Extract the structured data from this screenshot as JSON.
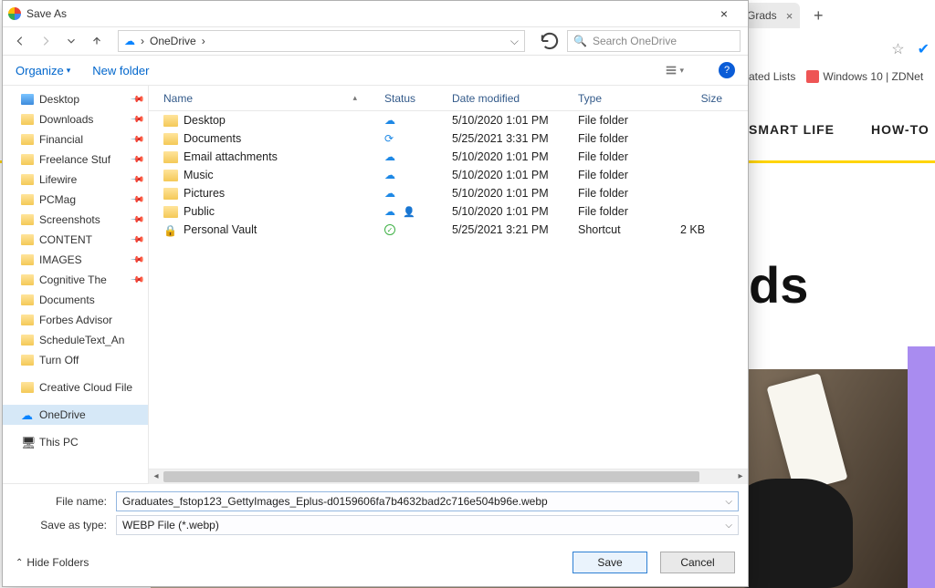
{
  "browser": {
    "tab_partial": "e Grads",
    "bookmarks": {
      "ated_lists": "ated Lists",
      "zdnet": "Windows 10 | ZDNet"
    },
    "nav": {
      "smartlife": "SMART LIFE",
      "howto": "HOW-TO"
    },
    "headline_partial": "ds"
  },
  "dialog": {
    "title": "Save As",
    "breadcrumb": {
      "root": "OneDrive",
      "chev": "›"
    },
    "search_placeholder": "Search OneDrive",
    "commands": {
      "organize": "Organize",
      "new_folder": "New folder"
    },
    "help_symbol": "?",
    "columns": {
      "name": "Name",
      "status": "Status",
      "date": "Date modified",
      "type": "Type",
      "size": "Size"
    },
    "tree": [
      {
        "label": "Desktop",
        "icon": "desk",
        "pinned": true
      },
      {
        "label": "Downloads",
        "icon": "folder",
        "pinned": true
      },
      {
        "label": "Financial",
        "icon": "folder",
        "pinned": true
      },
      {
        "label": "Freelance Stuf",
        "icon": "folder",
        "pinned": true
      },
      {
        "label": "Lifewire",
        "icon": "folder",
        "pinned": true
      },
      {
        "label": "PCMag",
        "icon": "folder",
        "pinned": true
      },
      {
        "label": "Screenshots",
        "icon": "folder",
        "pinned": true
      },
      {
        "label": "CONTENT",
        "icon": "folder",
        "pinned": true
      },
      {
        "label": "IMAGES",
        "icon": "folder",
        "pinned": true
      },
      {
        "label": "Cognitive The",
        "icon": "folder",
        "pinned": true
      },
      {
        "label": "Documents",
        "icon": "folder",
        "pinned": false
      },
      {
        "label": "Forbes Advisor",
        "icon": "folder",
        "pinned": false
      },
      {
        "label": "ScheduleText_An",
        "icon": "folder",
        "pinned": false
      },
      {
        "label": "Turn Off",
        "icon": "folder",
        "pinned": false
      },
      {
        "label": "Creative Cloud File",
        "icon": "cc",
        "pinned": false,
        "gapBefore": true
      },
      {
        "label": "OneDrive",
        "icon": "onedrive",
        "pinned": false,
        "selected": true,
        "gapBefore": true
      },
      {
        "label": "This PC",
        "icon": "pc",
        "pinned": false,
        "gapBefore": true
      }
    ],
    "files": [
      {
        "name": "Desktop",
        "status": "cloud",
        "date": "5/10/2020 1:01 PM",
        "type": "File folder",
        "size": ""
      },
      {
        "name": "Documents",
        "status": "sync",
        "date": "5/25/2021 3:31 PM",
        "type": "File folder",
        "size": ""
      },
      {
        "name": "Email attachments",
        "status": "cloud",
        "date": "5/10/2020 1:01 PM",
        "type": "File folder",
        "size": ""
      },
      {
        "name": "Music",
        "status": "cloud",
        "date": "5/10/2020 1:01 PM",
        "type": "File folder",
        "size": ""
      },
      {
        "name": "Pictures",
        "status": "cloud",
        "date": "5/10/2020 1:01 PM",
        "type": "File folder",
        "size": ""
      },
      {
        "name": "Public",
        "status": "cloud-share",
        "date": "5/10/2020 1:01 PM",
        "type": "File folder",
        "size": ""
      },
      {
        "name": "Personal Vault",
        "status": "ok",
        "date": "5/25/2021 3:21 PM",
        "type": "Shortcut",
        "size": "2 KB",
        "vault": true
      }
    ],
    "filename_label": "File name:",
    "filename_value": "Graduates_fstop123_GettyImages_Eplus-d0159606fa7b4632bad2c716e504b96e.webp",
    "type_label": "Save as type:",
    "type_value": "WEBP File (*.webp)",
    "hide_folders": "Hide Folders",
    "save": "Save",
    "cancel": "Cancel"
  }
}
